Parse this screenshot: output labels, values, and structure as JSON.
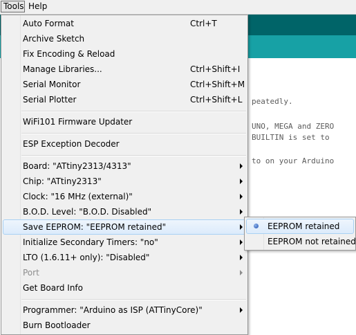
{
  "menubar": {
    "tools": "Tools",
    "help": "Help"
  },
  "code_lines": [
    "peatedly.",
    "UNO, MEGA and ZERO",
    "BUILTIN is set to",
    "to on your Arduino"
  ],
  "tools_menu": {
    "auto_format": {
      "label": "Auto Format",
      "shortcut": "Ctrl+T"
    },
    "archive_sketch": {
      "label": "Archive Sketch"
    },
    "fix_encoding": {
      "label": "Fix Encoding & Reload"
    },
    "manage_libraries": {
      "label": "Manage Libraries...",
      "shortcut": "Ctrl+Shift+I"
    },
    "serial_monitor": {
      "label": "Serial Monitor",
      "shortcut": "Ctrl+Shift+M"
    },
    "serial_plotter": {
      "label": "Serial Plotter",
      "shortcut": "Ctrl+Shift+L"
    },
    "wifi101": {
      "label": "WiFi101 Firmware Updater"
    },
    "esp_decoder": {
      "label": "ESP Exception Decoder"
    },
    "board": {
      "label": "Board: \"ATtiny2313/4313\""
    },
    "chip": {
      "label": "Chip: \"ATtiny2313\""
    },
    "clock": {
      "label": "Clock: \"16 MHz (external)\""
    },
    "bod": {
      "label": "B.O.D. Level: \"B.O.D. Disabled\""
    },
    "save_eeprom": {
      "label": "Save EEPROM: \"EEPROM retained\""
    },
    "init_timers": {
      "label": "Initialize Secondary Timers: \"no\""
    },
    "lto": {
      "label": "LTO (1.6.11+ only): \"Disabled\""
    },
    "port": {
      "label": "Port"
    },
    "board_info": {
      "label": "Get Board Info"
    },
    "programmer": {
      "label": "Programmer: \"Arduino as ISP (ATTinyCore)\""
    },
    "burn_bootloader": {
      "label": "Burn Bootloader"
    }
  },
  "eeprom_submenu": {
    "options": [
      "EEPROM retained",
      "EEPROM not retained"
    ],
    "selected": "EEPROM retained"
  },
  "colors": {
    "toolbar": "#006468",
    "tabbar": "#17a1a5",
    "menu_bg": "#f0f0f0",
    "highlight_border": "#a8d1f4"
  }
}
